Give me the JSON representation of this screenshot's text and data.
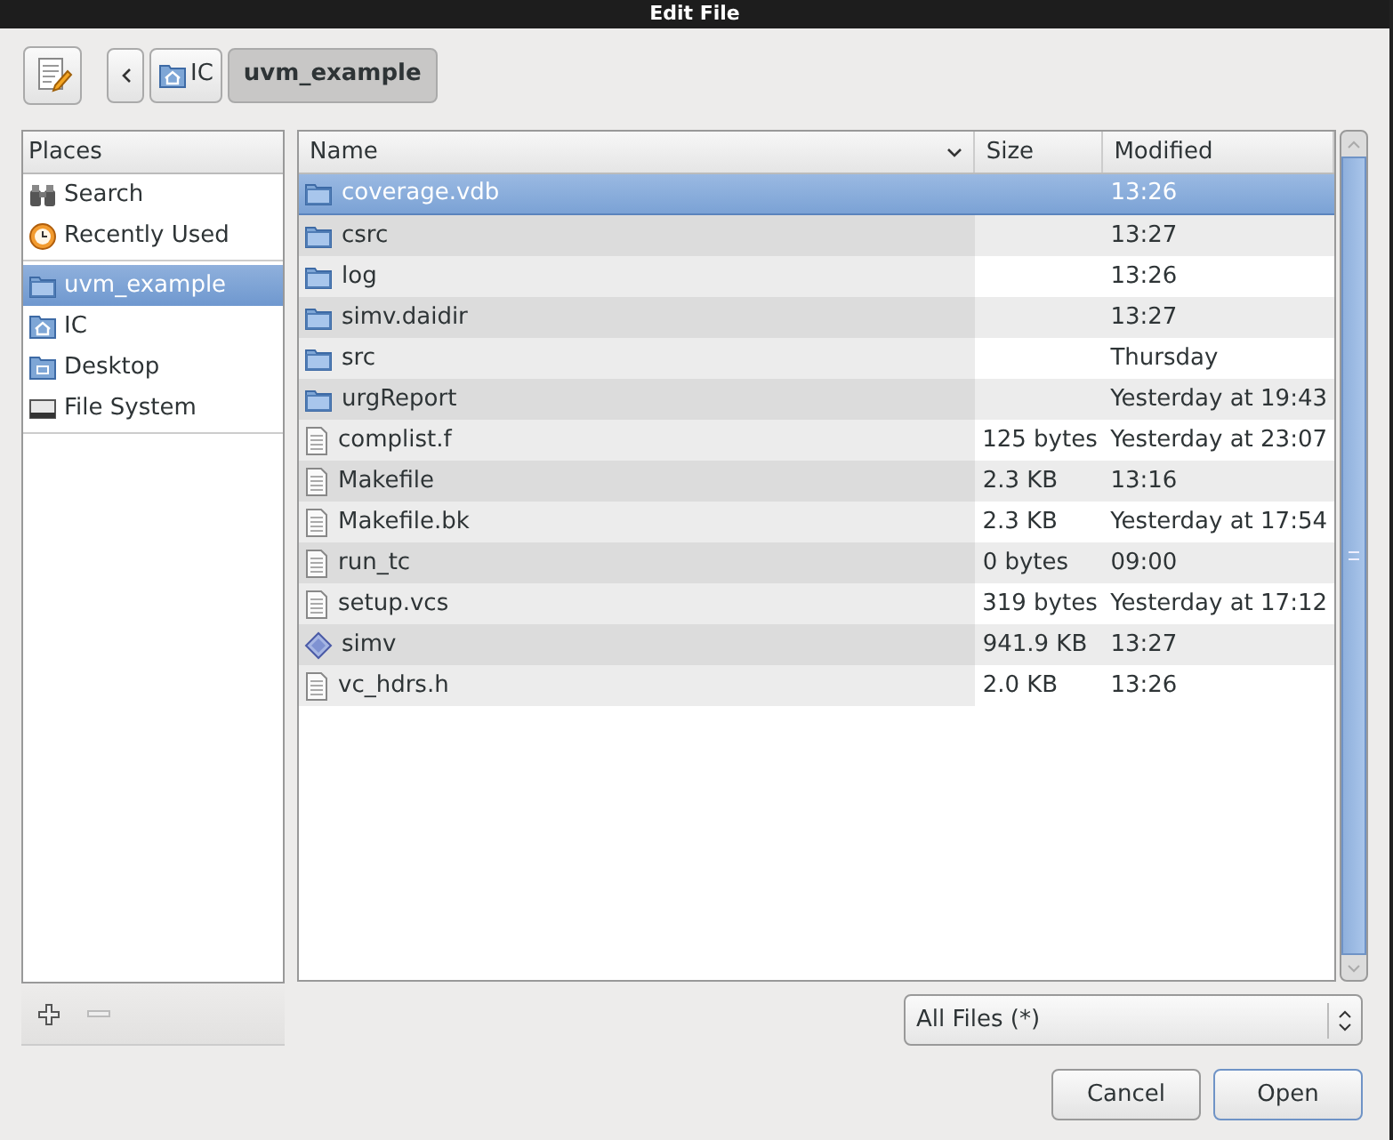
{
  "window": {
    "title": "Edit File"
  },
  "path_bar": [
    {
      "label": "IC",
      "kind": "home",
      "selected": false
    },
    {
      "label": "uvm_example",
      "kind": "plain",
      "selected": true
    }
  ],
  "places": {
    "title": "Places",
    "groups": [
      [
        {
          "label": "Search",
          "kind": "search",
          "selected": false
        },
        {
          "label": "Recently Used",
          "kind": "recent",
          "selected": false
        }
      ],
      [
        {
          "label": "uvm_example",
          "kind": "folder",
          "selected": true
        },
        {
          "label": "IC",
          "kind": "home",
          "selected": false
        },
        {
          "label": "Desktop",
          "kind": "desktop",
          "selected": false
        },
        {
          "label": "File System",
          "kind": "drive",
          "selected": false
        }
      ]
    ]
  },
  "table": {
    "columns": [
      "Name",
      "Size",
      "Modified"
    ],
    "rows": [
      {
        "name": "coverage.vdb",
        "size": "",
        "modified": "13:26",
        "kind": "folder",
        "selected": true
      },
      {
        "name": "csrc",
        "size": "",
        "modified": "13:27",
        "kind": "folder",
        "selected": false
      },
      {
        "name": "log",
        "size": "",
        "modified": "13:26",
        "kind": "folder",
        "selected": false
      },
      {
        "name": "simv.daidir",
        "size": "",
        "modified": "13:27",
        "kind": "folder",
        "selected": false
      },
      {
        "name": "src",
        "size": "",
        "modified": "Thursday",
        "kind": "folder",
        "selected": false
      },
      {
        "name": "urgReport",
        "size": "",
        "modified": "Yesterday at 19:43",
        "kind": "folder",
        "selected": false
      },
      {
        "name": "complist.f",
        "size": "125 bytes",
        "modified": "Yesterday at 23:07",
        "kind": "file",
        "selected": false
      },
      {
        "name": "Makefile",
        "size": "2.3 KB",
        "modified": "13:16",
        "kind": "file",
        "selected": false
      },
      {
        "name": "Makefile.bk",
        "size": "2.3 KB",
        "modified": "Yesterday at 17:54",
        "kind": "file",
        "selected": false
      },
      {
        "name": "run_tc",
        "size": "0 bytes",
        "modified": "09:00",
        "kind": "file",
        "selected": false
      },
      {
        "name": "setup.vcs",
        "size": "319 bytes",
        "modified": "Yesterday at 17:12",
        "kind": "file",
        "selected": false
      },
      {
        "name": "simv",
        "size": "941.9 KB",
        "modified": "13:27",
        "kind": "executable",
        "selected": false
      },
      {
        "name": "vc_hdrs.h",
        "size": "2.0 KB",
        "modified": "13:26",
        "kind": "file",
        "selected": false
      }
    ]
  },
  "filter": {
    "value": "All Files (*)"
  },
  "buttons": [
    "Cancel",
    "Open"
  ]
}
